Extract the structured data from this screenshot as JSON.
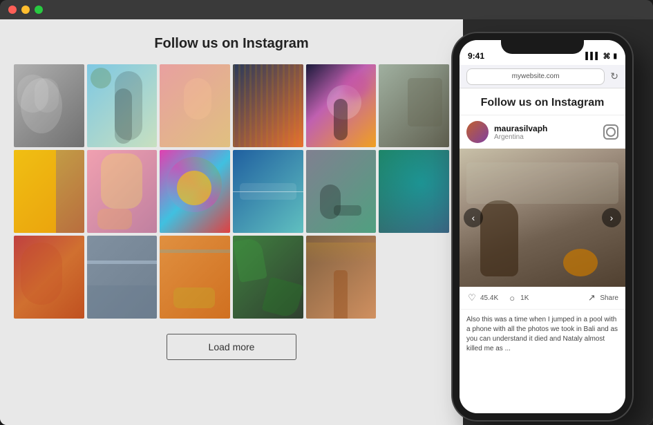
{
  "window": {
    "dots": [
      "red",
      "yellow",
      "green"
    ]
  },
  "desktop": {
    "background_color": "#e8e8e8"
  },
  "main": {
    "title": "Follow us on Instagram",
    "load_more_label": "Load more",
    "grid_photos": [
      {
        "id": 1,
        "class": "photo-1",
        "alt": "Two women laughing black and white"
      },
      {
        "id": 2,
        "class": "photo-2",
        "alt": "Person walking palm trees"
      },
      {
        "id": 3,
        "class": "photo-3",
        "alt": "Person sitting colorful street"
      },
      {
        "id": 4,
        "class": "photo-4",
        "alt": "Aerial city traffic night"
      },
      {
        "id": 5,
        "class": "photo-5",
        "alt": "Person standing sunset purple smoke"
      },
      {
        "id": 6,
        "class": "photo-6",
        "alt": "Rocky mountain landscape"
      },
      {
        "id": 7,
        "class": "photo-7",
        "alt": "Yellow building orange wall"
      },
      {
        "id": 8,
        "class": "photo-8",
        "alt": "Woman yellow shirt looking up"
      },
      {
        "id": 9,
        "class": "photo-9",
        "alt": "Colorful cat mural graffiti"
      },
      {
        "id": 10,
        "class": "photo-10",
        "alt": "Lake calm water minimal"
      },
      {
        "id": 11,
        "class": "photo-11",
        "alt": "Woman cycling road landscape"
      },
      {
        "id": 12,
        "class": "photo-12",
        "alt": "Teal ocean abstract"
      },
      {
        "id": 13,
        "class": "photo-13",
        "alt": "Woman portrait orange tones"
      },
      {
        "id": 14,
        "class": "photo-14",
        "alt": "Coastal aerial landscape"
      },
      {
        "id": 15,
        "class": "photo-15",
        "alt": "Desert road colorful van"
      },
      {
        "id": 16,
        "class": "photo-16",
        "alt": "Green tropical leaves"
      },
      {
        "id": 17,
        "class": "photo-17",
        "alt": "City tower sunset"
      }
    ]
  },
  "phone": {
    "status_bar": {
      "time": "9:41",
      "signal": "▌▌▌▌",
      "wifi": "WiFi",
      "battery": "🔋"
    },
    "browser": {
      "url": "mywebsite.com",
      "refresh_icon": "↻"
    },
    "page_title": "Follow us on Instagram",
    "post": {
      "username": "maurasilvaph",
      "location": "Argentina",
      "likes": "45.4K",
      "comments": "1K",
      "share_label": "Share",
      "caption": "Also this was a time when I jumped in a pool with a phone with all the photos we took in Bali and as you can understand it died and Nataly almost killed me as ..."
    },
    "nav": {
      "prev": "‹",
      "next": "›"
    }
  }
}
